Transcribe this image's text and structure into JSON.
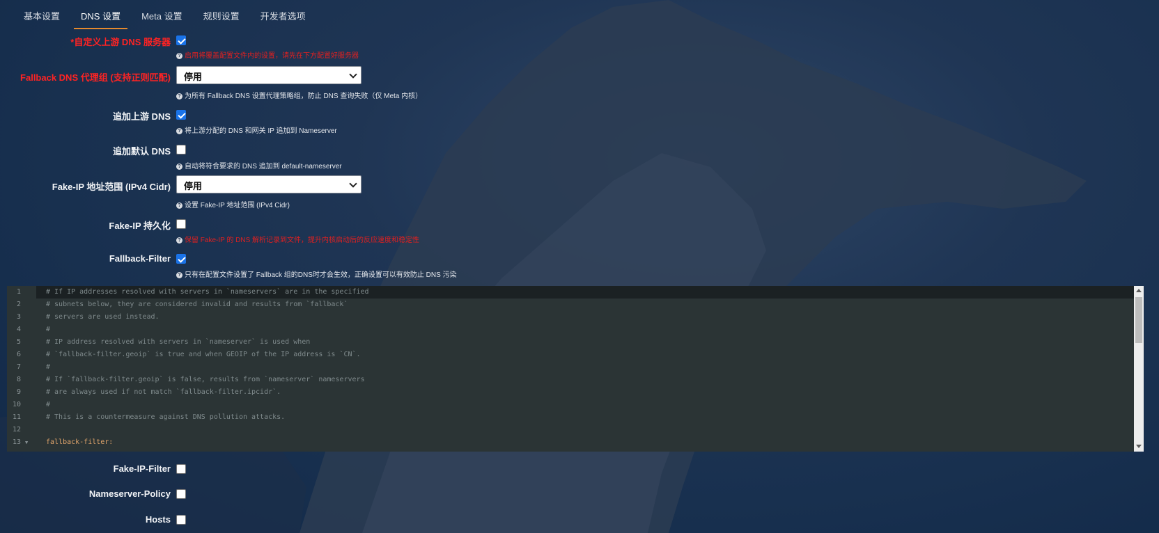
{
  "tabs": [
    "基本设置",
    "DNS 设置",
    "Meta 设置",
    "规则设置",
    "开发者选项"
  ],
  "active_tab": "DNS 设置",
  "fields": {
    "custom_upstream": {
      "label": "*自定义上游 DNS 服务器",
      "checked": true,
      "help": "启用将覆盖配置文件内的设置，请先在下方配置好服务器"
    },
    "fallback_proxy": {
      "label": "Fallback DNS 代理组 (支持正则匹配)",
      "value": "停用",
      "help": "为所有 Fallback DNS 设置代理策略组，防止 DNS 查询失败（仅 Meta 内核）"
    },
    "append_upstream": {
      "label": "追加上游 DNS",
      "checked": true,
      "help": "将上游分配的 DNS 和网关 IP 追加到 Nameserver"
    },
    "append_default": {
      "label": "追加默认 DNS",
      "checked": false,
      "help": "自动将符合要求的 DNS 追加到 default-nameserver"
    },
    "fake_ip_range": {
      "label": "Fake-IP 地址范围 (IPv4 Cidr)",
      "value": "停用",
      "help": "设置 Fake-IP 地址范围 (IPv4 Cidr)"
    },
    "fake_ip_persist": {
      "label": "Fake-IP 持久化",
      "checked": false,
      "help": "保留 Fake-IP 的 DNS 解析记录到文件，提升内核启动后的反应速度和稳定性"
    },
    "fallback_filter": {
      "label": "Fallback-Filter",
      "checked": true,
      "help": "只有在配置文件设置了 Fallback 组的DNS时才会生效，正确设置可以有效防止 DNS 污染"
    },
    "fake_ip_filter": {
      "label": "Fake-IP-Filter",
      "checked": false
    },
    "nameserver_policy": {
      "label": "Nameserver-Policy",
      "checked": false
    },
    "hosts": {
      "label": "Hosts",
      "checked": false
    }
  },
  "editor": {
    "lines": [
      {
        "n": "1",
        "text": "# If IP addresses resolved with servers in `nameservers` are in the specified"
      },
      {
        "n": "2",
        "text": "# subnets below, they are considered invalid and results from `fallback`"
      },
      {
        "n": "3",
        "text": "# servers are used instead."
      },
      {
        "n": "4",
        "text": "#"
      },
      {
        "n": "5",
        "text": "# IP address resolved with servers in `nameserver` is used when"
      },
      {
        "n": "6",
        "text": "# `fallback-filter.geoip` is true and when GEOIP of the IP address is `CN`."
      },
      {
        "n": "7",
        "text": "#"
      },
      {
        "n": "8",
        "text": "# If `fallback-filter.geoip` is false, results from `nameserver` nameservers"
      },
      {
        "n": "9",
        "text": "# are always used if not match `fallback-filter.ipcidr`."
      },
      {
        "n": "10",
        "text": "#"
      },
      {
        "n": "11",
        "text": "# This is a countermeasure against DNS pollution attacks."
      },
      {
        "n": "12",
        "text": ""
      },
      {
        "n": "13",
        "text": "fallback-filter:"
      }
    ]
  },
  "icons": {
    "help": "question-circle-icon",
    "select": "chevron-down-icon"
  },
  "colors": {
    "accent_red": "#ff2323",
    "checkbox_blue": "#1a73e8",
    "tab_underline": "#e58a2e"
  }
}
